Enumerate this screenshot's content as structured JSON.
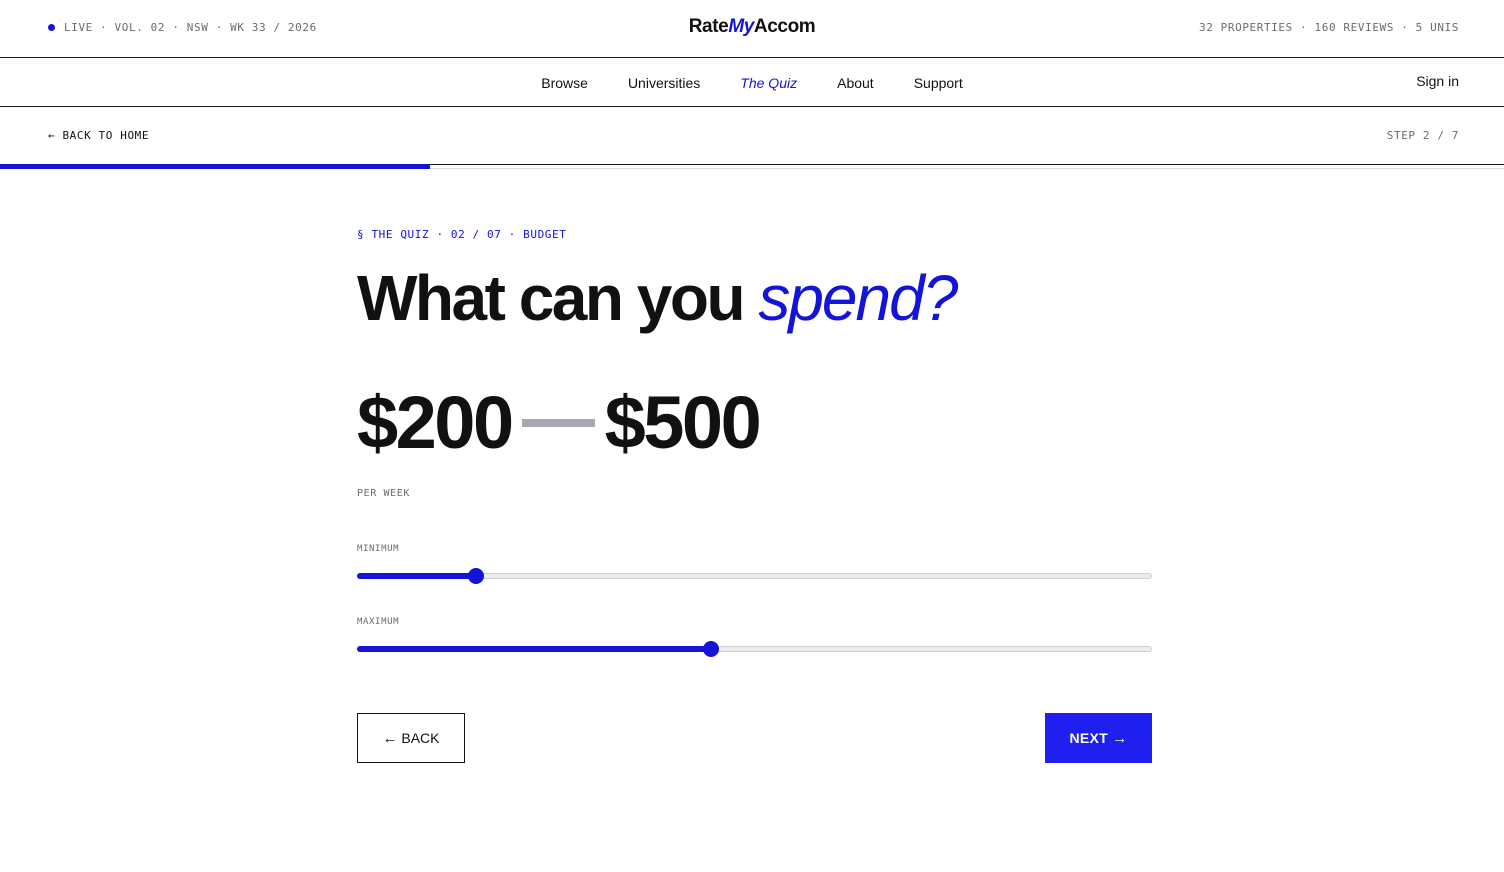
{
  "topbar": {
    "live_text": "LIVE · VOL. 02 · NSW · WK 33 / 2026",
    "logo_part1": "Rate",
    "logo_part2": "My",
    "logo_part3": "Accom",
    "stats": "32 PROPERTIES · 160 REVIEWS · 5 UNIS"
  },
  "nav": {
    "items": [
      {
        "label": "Browse"
      },
      {
        "label": "Universities"
      },
      {
        "label": "The Quiz"
      },
      {
        "label": "About"
      },
      {
        "label": "Support"
      }
    ],
    "active_index": 2,
    "sign_in": "Sign in"
  },
  "subbar": {
    "back_home": "← BACK TO HOME",
    "step": "STEP 2 / 7"
  },
  "progress": {
    "current_step": 2,
    "total_steps": 7
  },
  "quiz": {
    "eyebrow": "§ THE QUIZ · 02 / 07 · BUDGET",
    "headline_plain": "What can you ",
    "headline_accent": "spend?",
    "min_display": "$200",
    "max_display": "$500",
    "unit": "PER WEEK",
    "minimum_label": "MINIMUM",
    "maximum_label": "MAXIMUM",
    "min_slider_fraction": 0.15,
    "max_slider_fraction": 0.445
  },
  "actions": {
    "back_label": "BACK",
    "back_arrow": "←",
    "next_label": "NEXT",
    "next_arrow": "→"
  },
  "colors": {
    "accent": "#1414d6",
    "button_primary": "#1f1ff0",
    "muted_text": "#6b6b6b",
    "dash": "#a8a8b0"
  },
  "icons": {
    "live_indicator": "live-dot-icon",
    "back_arrow": "arrow-left-icon",
    "next_arrow": "arrow-right-icon"
  }
}
